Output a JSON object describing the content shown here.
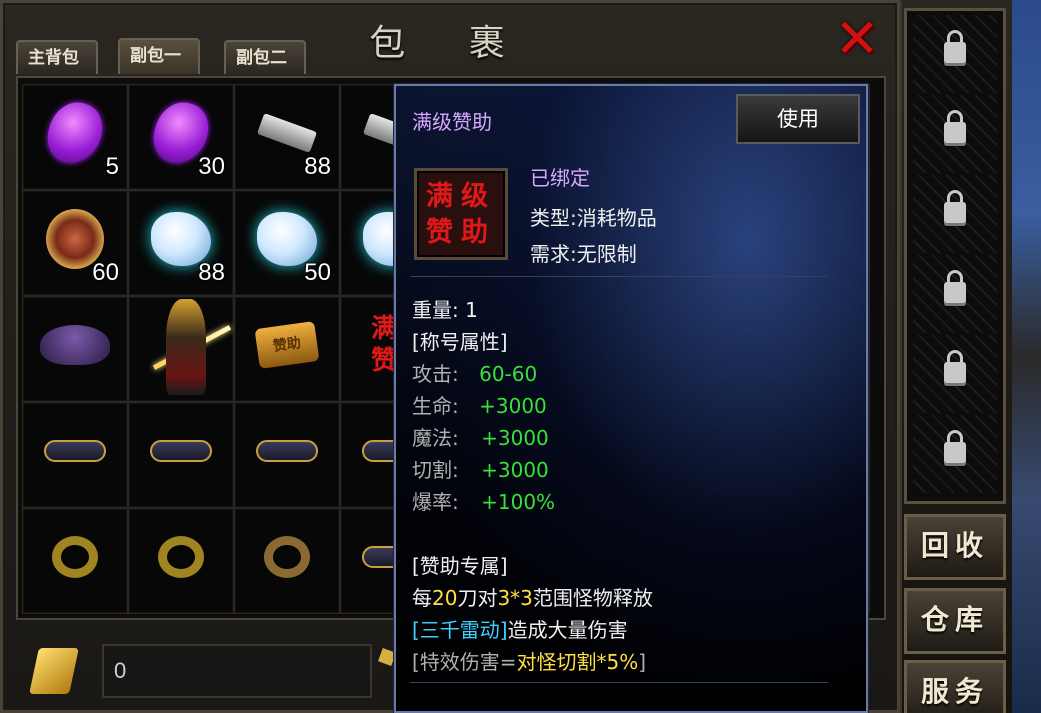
{
  "window": {
    "title": "包 裹",
    "close_icon": "red-x-icon"
  },
  "tabs": [
    {
      "label": "主背包"
    },
    {
      "label": "副包一"
    },
    {
      "label": "副包二"
    }
  ],
  "grid": {
    "rows": [
      [
        {
          "icon": "purple-gem-icon",
          "count": "5"
        },
        {
          "icon": "purple-gem-icon",
          "count": "30"
        },
        {
          "icon": "silver-scroll-icon",
          "count": "88"
        },
        {
          "icon": "silver-scroll-icon",
          "count": ""
        }
      ],
      [
        {
          "icon": "medal-icon",
          "count": "60"
        },
        {
          "icon": "crystal-icon",
          "count": "88"
        },
        {
          "icon": "crystal-icon",
          "count": "50"
        },
        {
          "icon": "crystal-icon",
          "count": ""
        }
      ],
      [
        {
          "icon": "wizard-hat-icon",
          "count": ""
        },
        {
          "icon": "warrior-icon",
          "count": ""
        },
        {
          "icon": "token-icon",
          "label": "赞助",
          "count": ""
        },
        {
          "icon": "sponsor-scroll-icon",
          "label": "满\n赞",
          "count": ""
        }
      ],
      [
        {
          "icon": "belt-icon",
          "count": ""
        },
        {
          "icon": "belt-icon",
          "count": ""
        },
        {
          "icon": "belt-icon",
          "count": ""
        },
        {
          "icon": "belt-icon",
          "count": ""
        }
      ],
      [
        {
          "icon": "gold-ring-icon",
          "count": ""
        },
        {
          "icon": "gold-ring-icon",
          "count": ""
        },
        {
          "icon": "bronze-ring-icon",
          "count": ""
        },
        {
          "icon": "belt-icon",
          "count": ""
        }
      ]
    ]
  },
  "currency": {
    "gold_value": "0"
  },
  "tooltip": {
    "item_name": "满级赞助",
    "use_button": "使用",
    "icon_text": "满级赞助",
    "bound": "已绑定",
    "type_label": "类型:",
    "type_value": "消耗物品",
    "require_label": "需求:",
    "require_value": "无限制",
    "weight_label": "重量:",
    "weight_value": "1",
    "title_section": "[称号属性]",
    "stats": [
      {
        "label": "攻击:",
        "value": "60-60"
      },
      {
        "label": "生命:",
        "value": "+3000"
      },
      {
        "label": "魔法:",
        "value": "+3000"
      },
      {
        "label": "切割:",
        "value": "+3000"
      },
      {
        "label": "爆率:",
        "value": "+100%"
      }
    ],
    "sponsor_section": "[赞助专属]",
    "effect_line1": {
      "a": "每",
      "b": "20",
      "c": "刀对",
      "d": "3*3",
      "e": "范围怪物释放"
    },
    "effect_line2": {
      "a": "[三千雷动]",
      "b": "造成大量伤害"
    },
    "effect_line3": {
      "a": "[特效伤害=",
      "b": "对怪切割*5%",
      "c": "]"
    }
  },
  "side_panel": {
    "lock_icon": "lock-icon",
    "buttons": [
      {
        "label": "回收"
      },
      {
        "label": "仓库"
      },
      {
        "label": "服务"
      }
    ]
  },
  "colors": {
    "stat_green": "#38e038",
    "highlight_yellow": "#ffe040",
    "skill_cyan": "#40d0ff",
    "bound_purple": "#d6a8ff",
    "close_red": "#d21010"
  }
}
